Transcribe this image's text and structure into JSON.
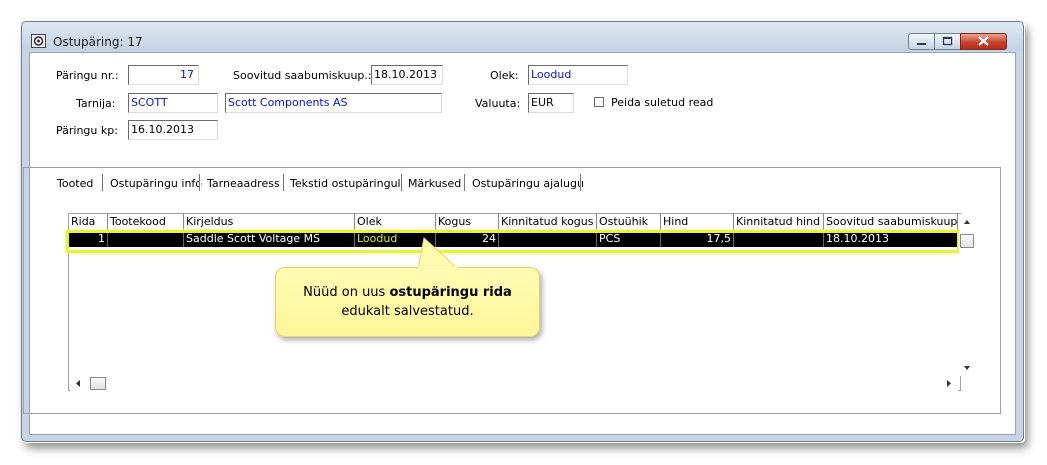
{
  "window": {
    "title": "Ostupäring: 17"
  },
  "form": {
    "paringu_nr_label": "Päringu nr.:",
    "paringu_nr_value": "17",
    "soovitud_label": "Soovitud saabumiskuup.:",
    "soovitud_value": "18.10.2013",
    "olek_label": "Olek:",
    "olek_value": "Loodud",
    "tarnija_label": "Tarnija:",
    "tarnija_code": "SCOTT",
    "tarnija_name": "Scott Components AS",
    "valuuta_label": "Valuuta:",
    "valuuta_value": "EUR",
    "peida_label": "Peida suletud read",
    "paringu_kp_label": "Päringu kp:",
    "paringu_kp_value": "16.10.2013"
  },
  "tabs": [
    {
      "label": "Tooted"
    },
    {
      "label": "Ostupäringu info"
    },
    {
      "label": "Tarneaadress"
    },
    {
      "label": "Tekstid ostupäringul"
    },
    {
      "label": "Märkused"
    },
    {
      "label": "Ostupäringu ajalugu"
    }
  ],
  "grid": {
    "columns": [
      "Rida",
      "Tootekood",
      "Kirjeldus",
      "Olek",
      "Kogus",
      "Kinnitatud kogus",
      "Ostuühik",
      "Hind",
      "Kinnitatud hind",
      "Soovitud saabumiskuup."
    ],
    "rows": [
      {
        "rida": "1",
        "tootekood": "",
        "kirjeldus": "Saddle Scott Voltage MS",
        "olek": "Loodud",
        "kogus": "24",
        "kinnitatud_kogus": "",
        "ostuuhik": "PCS",
        "hind": "17,5",
        "kinnitatud_hind": "",
        "soovitud": "18.10.2013"
      }
    ]
  },
  "callout": {
    "text_before": "Nüüd on uus ",
    "text_bold": "ostupäringu rida",
    "text_after": "edukalt salvestatud."
  },
  "colors": {
    "highlight": "#e6f33a",
    "callout_bg": "#fff7a6",
    "selected_row": "#000000",
    "status_text": "#e0e000",
    "link_blue": "#0015e0"
  }
}
